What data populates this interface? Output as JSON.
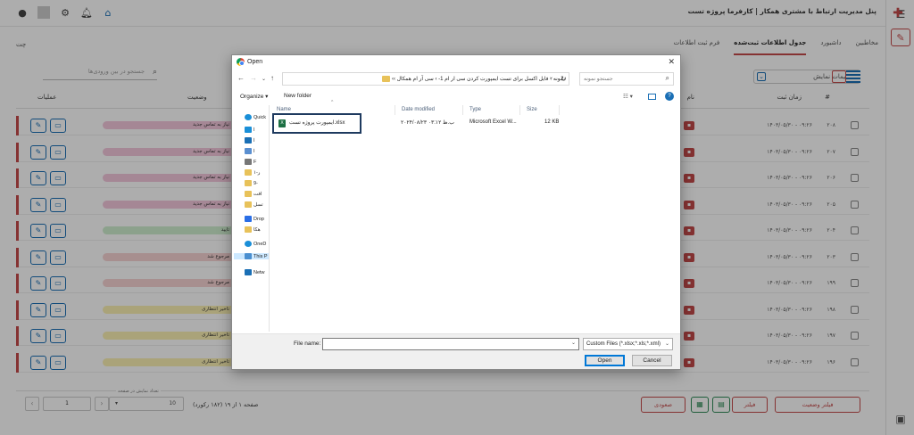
{
  "app": {
    "title": "پنل مدیریت ارتباط با مشتری همکار | کارفرما پروژه تست"
  },
  "tabs": [
    {
      "label": "فرم ثبت اطلاعات"
    },
    {
      "label": "جدول اطلاعات ثبت‌شده"
    },
    {
      "label": "داشبورد"
    },
    {
      "label": "مخاطبین"
    }
  ],
  "chat_label": "چت",
  "search": {
    "placeholder": "جستجو در بین ورودی‌ها"
  },
  "view_select": {
    "label": "تنظیمات نمایش"
  },
  "table": {
    "headers": {
      "row": "#",
      "time": "زمان ثبت",
      "name": "نام",
      "status": "وضعیت",
      "actions": "عملیات"
    },
    "rows": [
      {
        "num": "۲۰۸",
        "date": "۱۴۰۳/۰۵/۳۰ - ۰۹:۲۶",
        "status": "نیاز به تماس جدید",
        "status_color": "#f3c7dc"
      },
      {
        "num": "۲۰۷",
        "date": "۱۴۰۳/۰۵/۳۰ - ۰۹:۲۶",
        "status": "نیاز به تماس جدید",
        "status_color": "#f3c7dc"
      },
      {
        "num": "۲۰۶",
        "date": "۱۴۰۳/۰۵/۳۰ - ۰۹:۲۶",
        "status": "نیاز به تماس جدید",
        "status_color": "#f3c7dc"
      },
      {
        "num": "۲۰۵",
        "date": "۱۴۰۳/۰۵/۳۰ - ۰۹:۲۶",
        "status": "نیاز به تماس جدید",
        "status_color": "#f3c7dc"
      },
      {
        "num": "۲۰۴",
        "date": "۱۴۰۳/۰۵/۳۰ - ۰۹:۲۶",
        "status": "تایید",
        "status_color": "#cfeecf"
      },
      {
        "num": "۲۰۳",
        "date": "۱۴۰۳/۰۵/۳۰ - ۰۹:۲۶",
        "status": "مرجوع شد",
        "status_color": "#f7d3d3"
      },
      {
        "num": "۱۹۹",
        "date": "۱۴۰۳/۰۵/۳۰ - ۰۹:۲۶",
        "status": "مرجوع شد",
        "status_color": "#f7d3d3"
      },
      {
        "num": "۱۹۸",
        "date": "۱۴۰۳/۰۵/۳۰ - ۰۹:۲۶",
        "status": "تاخیر انتظاری",
        "status_color": "#fbf0b3"
      },
      {
        "num": "۱۹۷",
        "date": "۱۴۰۳/۰۵/۳۰ - ۰۹:۲۶",
        "status": "تاخیر انتظاری",
        "status_color": "#fbf0b3"
      },
      {
        "num": "۱۹۶",
        "date": "۱۴۰۳/۰۵/۳۰ - ۰۹:۲۶",
        "status": "تاخیر انتظاری",
        "status_color": "#fbf0b3"
      }
    ]
  },
  "footer": {
    "page_info": "صفحه ۱ از ۱۹ (۱۸۲ رکورد)",
    "page_value": "1",
    "per_page_label": "تعداد نمایش در صفحه",
    "per_page_value": "10",
    "filter_status": "فیلتر وضعیت",
    "filter": "فیلتر",
    "seoudi": "صعودی"
  },
  "dialog": {
    "title": "Open",
    "address": "نمونه  ›  فایل اکسل برای تست ایمپورت کردن سی ار ام 1-  ›  سی آر ام همکال  ››",
    "search_placeholder": "جستجو نمونه",
    "organize": "Organize ▾",
    "new_folder": "New folder",
    "nav_items": [
      "Quick",
      "Drop",
      "OneD",
      "This P",
      "Netw"
    ],
    "columns": {
      "name": "Name",
      "date": "Date modified",
      "type": "Type",
      "size": "Size"
    },
    "file": {
      "name": "ایمپورت پروژه تست.xlsx",
      "date": "۲۰۲۴/۰۸/۲۳ ب.ظ ۰۳:۱۲",
      "type": "Microsoft Excel W...",
      "size": "12 KB"
    },
    "file_name_label": "File name:",
    "file_name_value": "",
    "file_type": "Custom Files (*.xlsx;*.xls;*.xml)",
    "open": "Open",
    "cancel": "Cancel"
  },
  "colors": {
    "accent": "#c54a4a",
    "primary": "#1a6fb5",
    "excel": "#1d7044"
  }
}
